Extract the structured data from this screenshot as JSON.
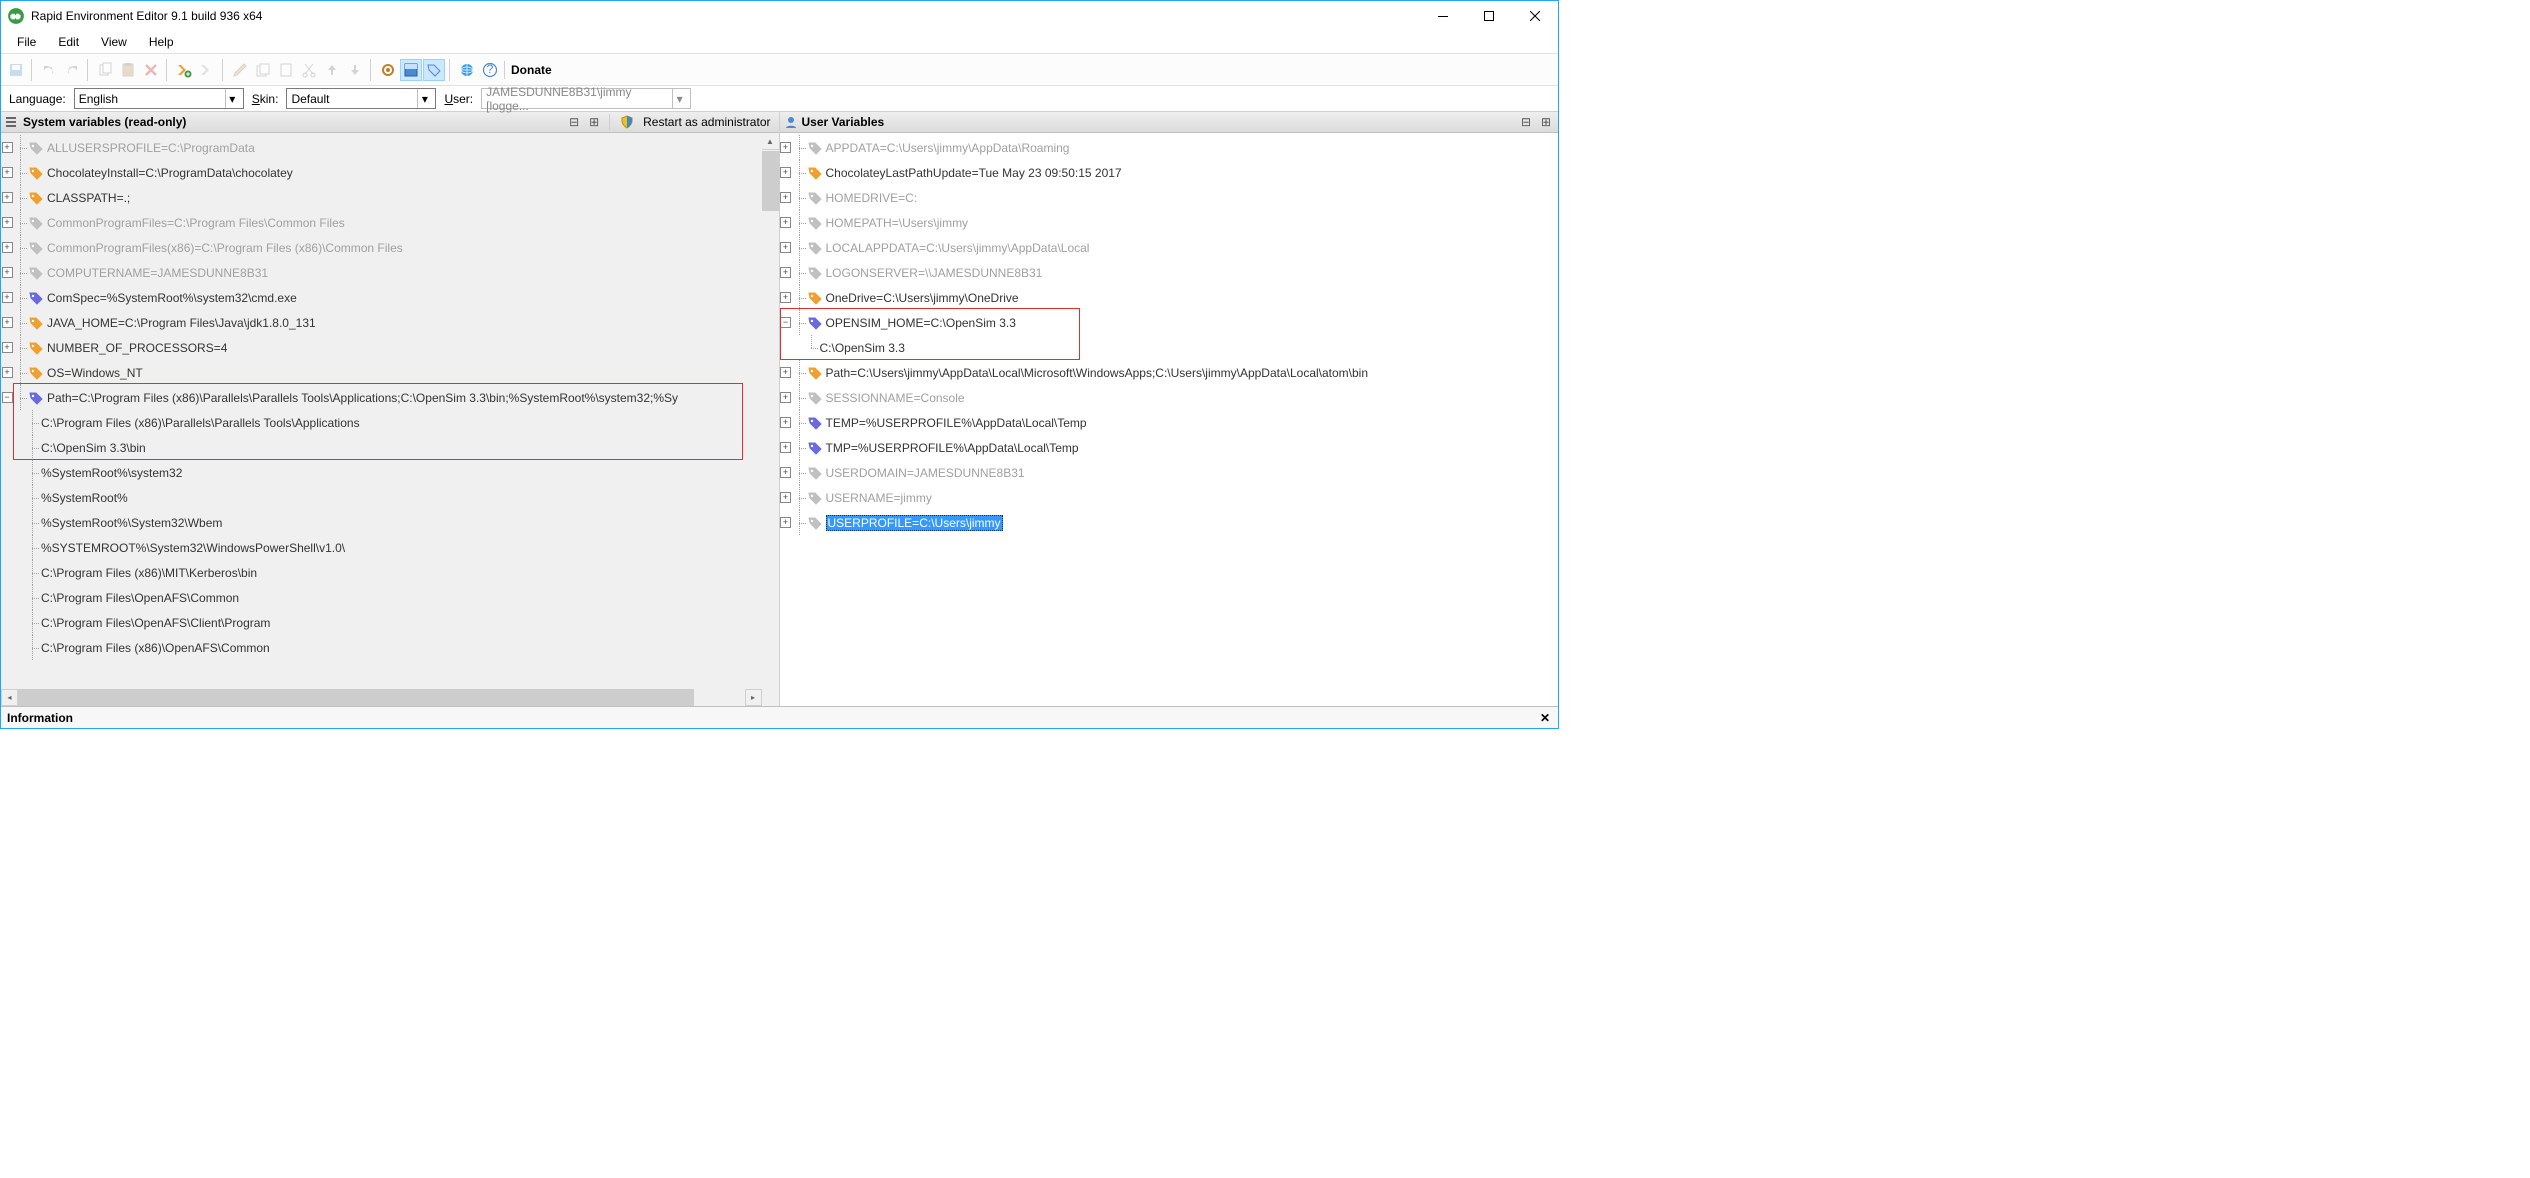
{
  "title": "Rapid Environment Editor 9.1 build 936 x64",
  "menus": [
    "File",
    "Edit",
    "View",
    "Help"
  ],
  "donate": "Donate",
  "opts": {
    "lang_lbl": "Language:",
    "lang_val": "English",
    "skin_lbl": "Skin:",
    "skin_val": "Default",
    "user_lbl": "User:",
    "user_val": "JAMESDUNNE8B31\\jimmy [logge..."
  },
  "left": {
    "header": "System variables (read-only)",
    "restart": "Restart as administrator",
    "vars": [
      {
        "t": "ALLUSERSPROFILE=C:\\ProgramData",
        "dim": true,
        "icon": "grey"
      },
      {
        "t": "ChocolateyInstall=C:\\ProgramData\\chocolatey",
        "dim": false,
        "icon": "orange"
      },
      {
        "t": "CLASSPATH=.;",
        "dim": false,
        "icon": "orange"
      },
      {
        "t": "CommonProgramFiles=C:\\Program Files\\Common Files",
        "dim": true,
        "icon": "grey"
      },
      {
        "t": "CommonProgramFiles(x86)=C:\\Program Files (x86)\\Common Files",
        "dim": true,
        "icon": "grey"
      },
      {
        "t": "COMPUTERNAME=JAMESDUNNE8B31",
        "dim": true,
        "icon": "grey"
      },
      {
        "t": "ComSpec=%SystemRoot%\\system32\\cmd.exe",
        "dim": false,
        "icon": "blue"
      },
      {
        "t": "JAVA_HOME=C:\\Program Files\\Java\\jdk1.8.0_131",
        "dim": false,
        "icon": "orange"
      },
      {
        "t": "NUMBER_OF_PROCESSORS=4",
        "dim": false,
        "icon": "orange"
      },
      {
        "t": "OS=Windows_NT",
        "dim": false,
        "icon": "orange"
      }
    ],
    "path_label": "Path=C:\\Program Files (x86)\\Parallels\\Parallels Tools\\Applications;C:\\OpenSim 3.3\\bin;%SystemRoot%\\system32;%Sy",
    "path_children_highlighted": [
      "C:\\Program Files (x86)\\Parallels\\Parallels Tools\\Applications",
      "C:\\OpenSim 3.3\\bin"
    ],
    "path_children": [
      "%SystemRoot%\\system32",
      "%SystemRoot%",
      "%SystemRoot%\\System32\\Wbem",
      "%SYSTEMROOT%\\System32\\WindowsPowerShell\\v1.0\\",
      "C:\\Program Files (x86)\\MIT\\Kerberos\\bin",
      "C:\\Program Files\\OpenAFS\\Common",
      "C:\\Program Files\\OpenAFS\\Client\\Program",
      "C:\\Program Files (x86)\\OpenAFS\\Common"
    ]
  },
  "right": {
    "header": "User Variables",
    "vars": [
      {
        "t": "APPDATA=C:\\Users\\jimmy\\AppData\\Roaming",
        "dim": true,
        "icon": "grey"
      },
      {
        "t": "ChocolateyLastPathUpdate=Tue May 23 09:50:15 2017",
        "dim": false,
        "icon": "orange"
      },
      {
        "t": "HOMEDRIVE=C:",
        "dim": true,
        "icon": "grey"
      },
      {
        "t": "HOMEPATH=\\Users\\jimmy",
        "dim": true,
        "icon": "grey"
      },
      {
        "t": "LOCALAPPDATA=C:\\Users\\jimmy\\AppData\\Local",
        "dim": true,
        "icon": "grey"
      },
      {
        "t": "LOGONSERVER=\\\\JAMESDUNNE8B31",
        "dim": true,
        "icon": "grey"
      },
      {
        "t": "OneDrive=C:\\Users\\jimmy\\OneDrive",
        "dim": false,
        "icon": "orange"
      }
    ],
    "opensim": {
      "label": "OPENSIM_HOME=C:\\OpenSim 3.3",
      "child": "C:\\OpenSim 3.3"
    },
    "vars2": [
      {
        "t": "Path=C:\\Users\\jimmy\\AppData\\Local\\Microsoft\\WindowsApps;C:\\Users\\jimmy\\AppData\\Local\\atom\\bin",
        "dim": false,
        "icon": "orange"
      },
      {
        "t": "SESSIONNAME=Console",
        "dim": true,
        "icon": "grey"
      },
      {
        "t": "TEMP=%USERPROFILE%\\AppData\\Local\\Temp",
        "dim": false,
        "icon": "blue"
      },
      {
        "t": "TMP=%USERPROFILE%\\AppData\\Local\\Temp",
        "dim": false,
        "icon": "blue"
      },
      {
        "t": "USERDOMAIN=JAMESDUNNE8B31",
        "dim": true,
        "icon": "grey"
      },
      {
        "t": "USERNAME=jimmy",
        "dim": true,
        "icon": "grey"
      }
    ],
    "selected": "USERPROFILE=C:\\Users\\jimmy"
  },
  "status": "Information"
}
